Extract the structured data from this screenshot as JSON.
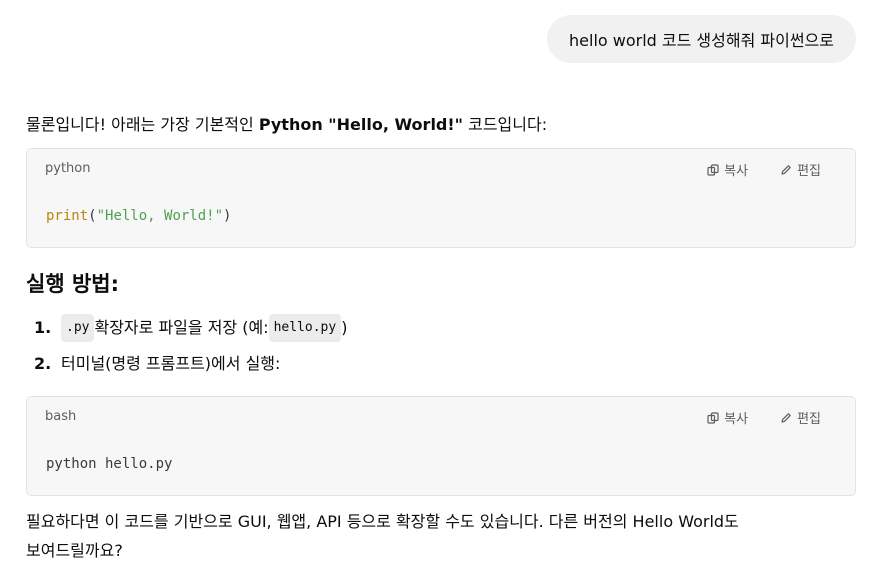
{
  "user_message": "hello world 코드 생성해줘 파이썬으로",
  "intro": {
    "before": "물론입니다! 아래는 가장 기본적인 ",
    "bold": "Python \"Hello, World!\"",
    "after": " 코드입니다:"
  },
  "code_block_1": {
    "language": "python",
    "copy_label": "복사",
    "edit_label": "편집",
    "tokens": {
      "fn": "print",
      "open": "(",
      "str": "\"Hello, World!\"",
      "close": ")"
    }
  },
  "run_heading": "실행 방법:",
  "steps": [
    {
      "num": "1.",
      "code1": ".py",
      "text1": " 확장자로 파일을 저장 (예: ",
      "code2": "hello.py",
      "text2": ")"
    },
    {
      "num": "2.",
      "text": "터미널(명령 프롬프트)에서 실행:"
    }
  ],
  "code_block_2": {
    "language": "bash",
    "copy_label": "복사",
    "edit_label": "편집",
    "code": "python hello.py"
  },
  "outro_line1": "필요하다면 이 코드를 기반으로 GUI, 웹앱, API 등으로 확장할 수도 있습니다. 다른 버전의 Hello World도",
  "outro_line2": "보여드릴까요?"
}
